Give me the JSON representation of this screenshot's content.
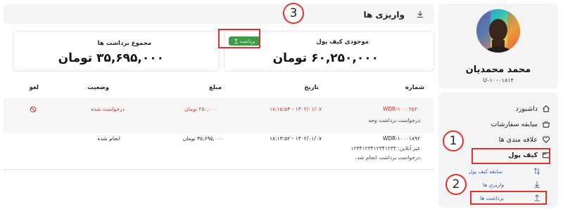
{
  "user": {
    "name": "محمد محمدیان",
    "id": "U-۱۰۰۰۱۸۱۴"
  },
  "menu": {
    "items": [
      {
        "label": "داشبورد",
        "icon": "home-icon"
      },
      {
        "label": "سابقه سفارشات",
        "icon": "basket-icon"
      },
      {
        "label": "علاقه مندی ها",
        "icon": "heart-icon"
      },
      {
        "label": "کیف پول",
        "icon": "wallet-icon"
      }
    ],
    "wallet_sub": [
      {
        "label": "سابقه کیف پول",
        "icon": "swap-icon"
      },
      {
        "label": "واریزی ها",
        "icon": "arrow-down-icon"
      },
      {
        "label": "برداشت ها",
        "icon": "arrow-up-icon"
      }
    ]
  },
  "header": {
    "title": "واریزی ها",
    "icon": "download-icon"
  },
  "cards": {
    "balance_label": "موجودی کیف پول",
    "balance_value": "۶۰,۲۵۰,۰۰۰ تومان",
    "withdraw_button": "برداشت",
    "total_label": "مجموع برداشت ها",
    "total_value": "۳۵,۶۹۵,۰۰۰ تومان"
  },
  "table": {
    "columns": [
      "شماره",
      "تاریخ",
      "مبلغ",
      "وضعیت",
      "لغو"
    ],
    "rows": [
      {
        "number": "WDR-۱۰۰۰۲۵۲۰",
        "note1": "درخواست برداشت وجه",
        "date": "۱۴۰۲/۰۱/۰۷ - ۱۸:۱۵:۵۳",
        "amount": "۲۵۰,۰۰۰ تومان",
        "status": "درخواست شده",
        "cancel_icon": "cancel-icon"
      },
      {
        "number": "WDR-۱۰۰۰۱۸۹۲",
        "note1": "غیر آنلاین: ۱۲۳۴۱۲۳۴۱۲۳۴۱۲۳۴",
        "note2": "درخواست برداشت انجام شد.",
        "date": "۱۴۰۲/۰۱/۰۷ - ۱۸:۱۳:۵۲",
        "amount": "۳۵,۶۹۵,۰۰۰ تومان",
        "status": "انجام شده"
      }
    ]
  },
  "annotations": [
    "1",
    "2",
    "3"
  ],
  "colors": {
    "accent_green": "#3d9b4a",
    "alert_red": "#d12f2f",
    "annotation_red": "#e0332f",
    "link_blue": "#3a5ba0"
  }
}
